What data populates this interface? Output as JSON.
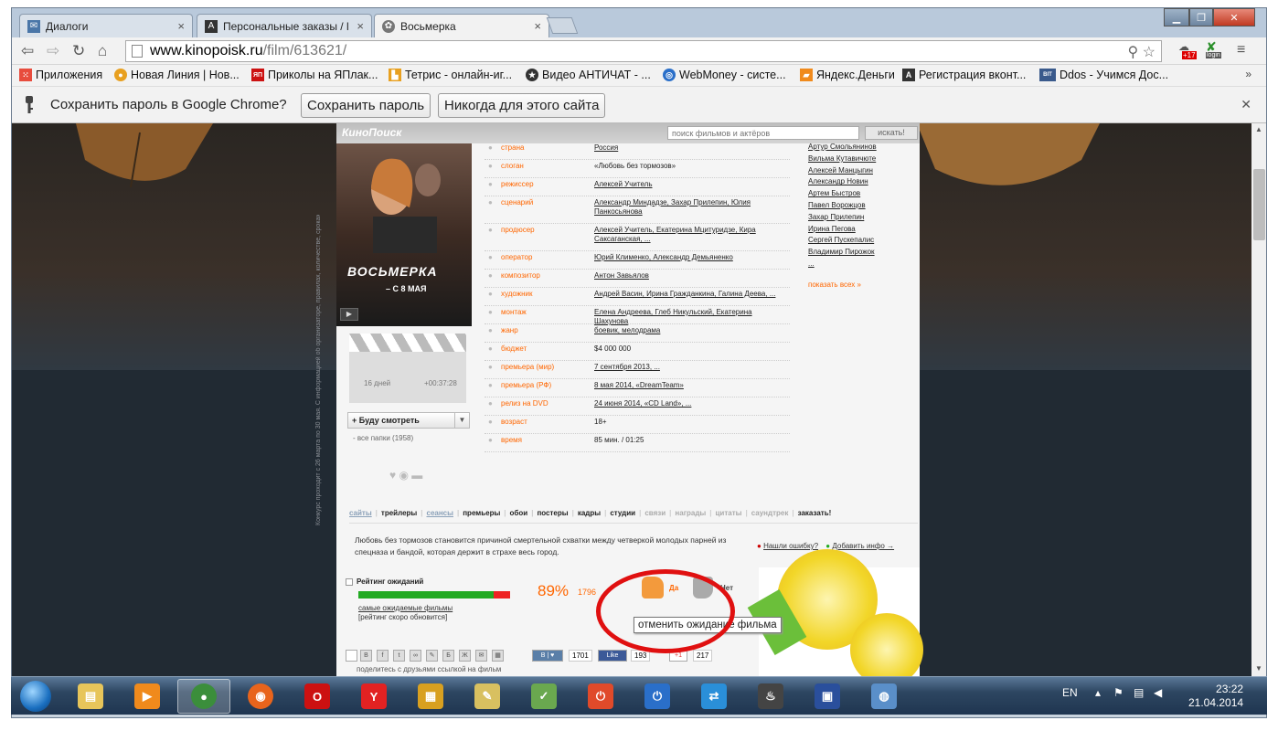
{
  "tabs": [
    {
      "label": "Диалоги",
      "icon": "message-icon",
      "color": "#4a76a8"
    },
    {
      "label": "Персональные заказы / l",
      "icon": "advego-icon",
      "color": "#333333"
    },
    {
      "label": "Восьмерка",
      "icon": "kinopoisk-icon",
      "color": "#777777"
    }
  ],
  "address": {
    "host": "www.kinopoisk.ru",
    "path": "/film/613621/"
  },
  "extensions": {
    "badge": "+17",
    "login": "login"
  },
  "bookmarks": [
    {
      "label": "Приложения",
      "icon": "apps-icon",
      "color": "#e84c3d"
    },
    {
      "label": "Новая Линия | Нов...",
      "icon": "nl-icon",
      "color": "#e8a020"
    },
    {
      "label": "Приколы на ЯПлак...",
      "icon": "yap-icon",
      "color": "#cc1111"
    },
    {
      "label": "Тетрис - онлайн-иг...",
      "icon": "tetris-icon",
      "color": "#e8a020"
    },
    {
      "label": "Видео АНТИЧАТ - ...",
      "icon": "antichat-icon",
      "color": "#333333"
    },
    {
      "label": "WebMoney - систе...",
      "icon": "webmoney-icon",
      "color": "#2a6fc9"
    },
    {
      "label": "Яндекс.Деньги",
      "icon": "yamoney-icon",
      "color": "#f08a1c"
    },
    {
      "label": "Регистрация вконт...",
      "icon": "advego-icon",
      "color": "#333333"
    },
    {
      "label": "Ddos - Учимся Дос...",
      "icon": "bit-icon",
      "color": "#3a5a8c"
    }
  ],
  "bookmark_bitlabel": "BIT",
  "infobar": {
    "message": "Сохранить пароль в Google Chrome?",
    "save_label": "Сохранить пароль",
    "never_label": "Никогда для этого сайта"
  },
  "kp": {
    "logo": "КиноПоиск",
    "search_placeholder": "поиск фильмов и актёров",
    "search_button": "искать!",
    "poster_title": "ВОСЬМЕРКА",
    "poster_date": "– С 8 МАЯ",
    "countdown_days": "16 дней",
    "countdown_time": "+00:37:28",
    "will_watch": "+ Буду смотреть",
    "folders": "- все папки (1958)",
    "sidebar_text": "Конкурс проходит с 26 марта по 30 мая. С информацией об организаторе, правилах, количестве, сроках, месте и порядке получения призов можно ознакомиться на сайте",
    "info": [
      {
        "label": "страна",
        "value": "Россия"
      },
      {
        "label": "слоган",
        "value": "«Любовь без тормозов»"
      },
      {
        "label": "режиссер",
        "value": "Алексей Учитель"
      },
      {
        "label": "сценарий",
        "value": "Александр Миндадзе, Захар Прилепин, Юлия Панкосьянова"
      },
      {
        "label": "продюсер",
        "value": "Алексей Учитель, Екатерина Мцитуридзе, Кира Саксаганская, ..."
      },
      {
        "label": "оператор",
        "value": "Юрий Клименко, Александр Демьяненко"
      },
      {
        "label": "композитор",
        "value": "Антон Завьялов"
      },
      {
        "label": "художник",
        "value": "Андрей Васин, Ирина Гражданкина, Галина Деева, ..."
      },
      {
        "label": "монтаж",
        "value": "Елена Андреева, Глеб Никульский, Екатерина Шахунова"
      },
      {
        "label": "жанр",
        "value": "боевик, мелодрама"
      },
      {
        "label": "бюджет",
        "value": "$4 000 000"
      },
      {
        "label": "премьера (мир)",
        "value": "7 сентября 2013, ..."
      },
      {
        "label": "премьера (РФ)",
        "value": "8 мая 2014, «DreamTeam»"
      },
      {
        "label": "релиз на DVD",
        "value": "24 июня 2014, «CD Land», ..."
      },
      {
        "label": "возраст",
        "value": "18+"
      },
      {
        "label": "время",
        "value": "85 мин. / 01:25"
      }
    ],
    "cast": [
      "Артур Смольянинов",
      "Вильма Кутавичюте",
      "Алексей Манцыгин",
      "Александр Новин",
      "Артем Быстров",
      "Павел Ворожцов",
      "Захар Прилепин",
      "Ирина Пегова",
      "Сергей Пускепалис",
      "Владимир Пирожок",
      "..."
    ],
    "cast_more": "показать всех »",
    "navtabs": [
      {
        "label": "сайты",
        "color": "#8aa0b8"
      },
      {
        "label": "трейлеры",
        "color": "#222222"
      },
      {
        "label": "сеансы",
        "color": "#8aa0b8"
      },
      {
        "label": "премьеры",
        "color": "#222222"
      },
      {
        "label": "обои",
        "color": "#222222"
      },
      {
        "label": "постеры",
        "color": "#222222"
      },
      {
        "label": "кадры",
        "color": "#222222"
      },
      {
        "label": "студии",
        "color": "#222222"
      },
      {
        "label": "связи",
        "color": "#aaaaaa"
      },
      {
        "label": "награды",
        "color": "#aaaaaa"
      },
      {
        "label": "цитаты",
        "color": "#aaaaaa"
      },
      {
        "label": "саундтрек",
        "color": "#aaaaaa"
      },
      {
        "label": "заказать!",
        "color": "#222222"
      }
    ],
    "description": "Любовь без тормозов становится причиной смертельной схватки между четверкой молодых парней из спецназа и бандой, которая держит в страхе весь город.",
    "error_link": "Нашли ошибку?",
    "add_info": "Добавить инфо →",
    "expect_title": "Рейтинг ожиданий",
    "expect_ratio": 0.89,
    "expect_pct": "89%",
    "expect_votes": "1796",
    "expect_link": "самые ожидаемые фильмы",
    "expect_note": "[рейтинг скоро обновится]",
    "yes_label": "Да",
    "no_label": "Нет",
    "tooltip": "отменить ожидание фильма",
    "share_counts": {
      "vk": "1701",
      "fb_label": "Like",
      "fb": "193",
      "gplus_label": "+1",
      "gplus": "217"
    },
    "share_text": "поделитесь с друзьями ссылкой на фильм"
  },
  "taskbar": {
    "apps": [
      {
        "name": "explorer-icon",
        "color": "#e7c55a",
        "glyph": "▤"
      },
      {
        "name": "media-player-icon",
        "color": "#f08a1c",
        "glyph": "▶"
      },
      {
        "name": "chrome-icon",
        "color": "#3b8e3b",
        "glyph": "●"
      },
      {
        "name": "firefox-icon",
        "color": "#e8641c",
        "glyph": "◉"
      },
      {
        "name": "opera-icon",
        "color": "#cc1111",
        "glyph": "O"
      },
      {
        "name": "yandex-icon",
        "color": "#e22222",
        "glyph": "Y"
      },
      {
        "name": "rar-icon",
        "color": "#d8a020",
        "glyph": "▦"
      },
      {
        "name": "paint-icon",
        "color": "#d8c060",
        "glyph": "✎"
      },
      {
        "name": "notepad-icon",
        "color": "#6aa84f",
        "glyph": "✓"
      },
      {
        "name": "power-red-icon",
        "color": "#e04a2a",
        "glyph": "⏻"
      },
      {
        "name": "power-blue-icon",
        "color": "#2a6fc9",
        "glyph": "⏻"
      },
      {
        "name": "sync-icon",
        "color": "#2a8fd9",
        "glyph": "⇄"
      },
      {
        "name": "steam-icon",
        "color": "#444444",
        "glyph": "♨"
      },
      {
        "name": "save-icon",
        "color": "#2a4f9c",
        "glyph": "▣"
      },
      {
        "name": "globe-icon",
        "color": "#5a8fc9",
        "glyph": "◍"
      }
    ],
    "lang": "EN",
    "time": "23:22",
    "date": "21.04.2014"
  }
}
